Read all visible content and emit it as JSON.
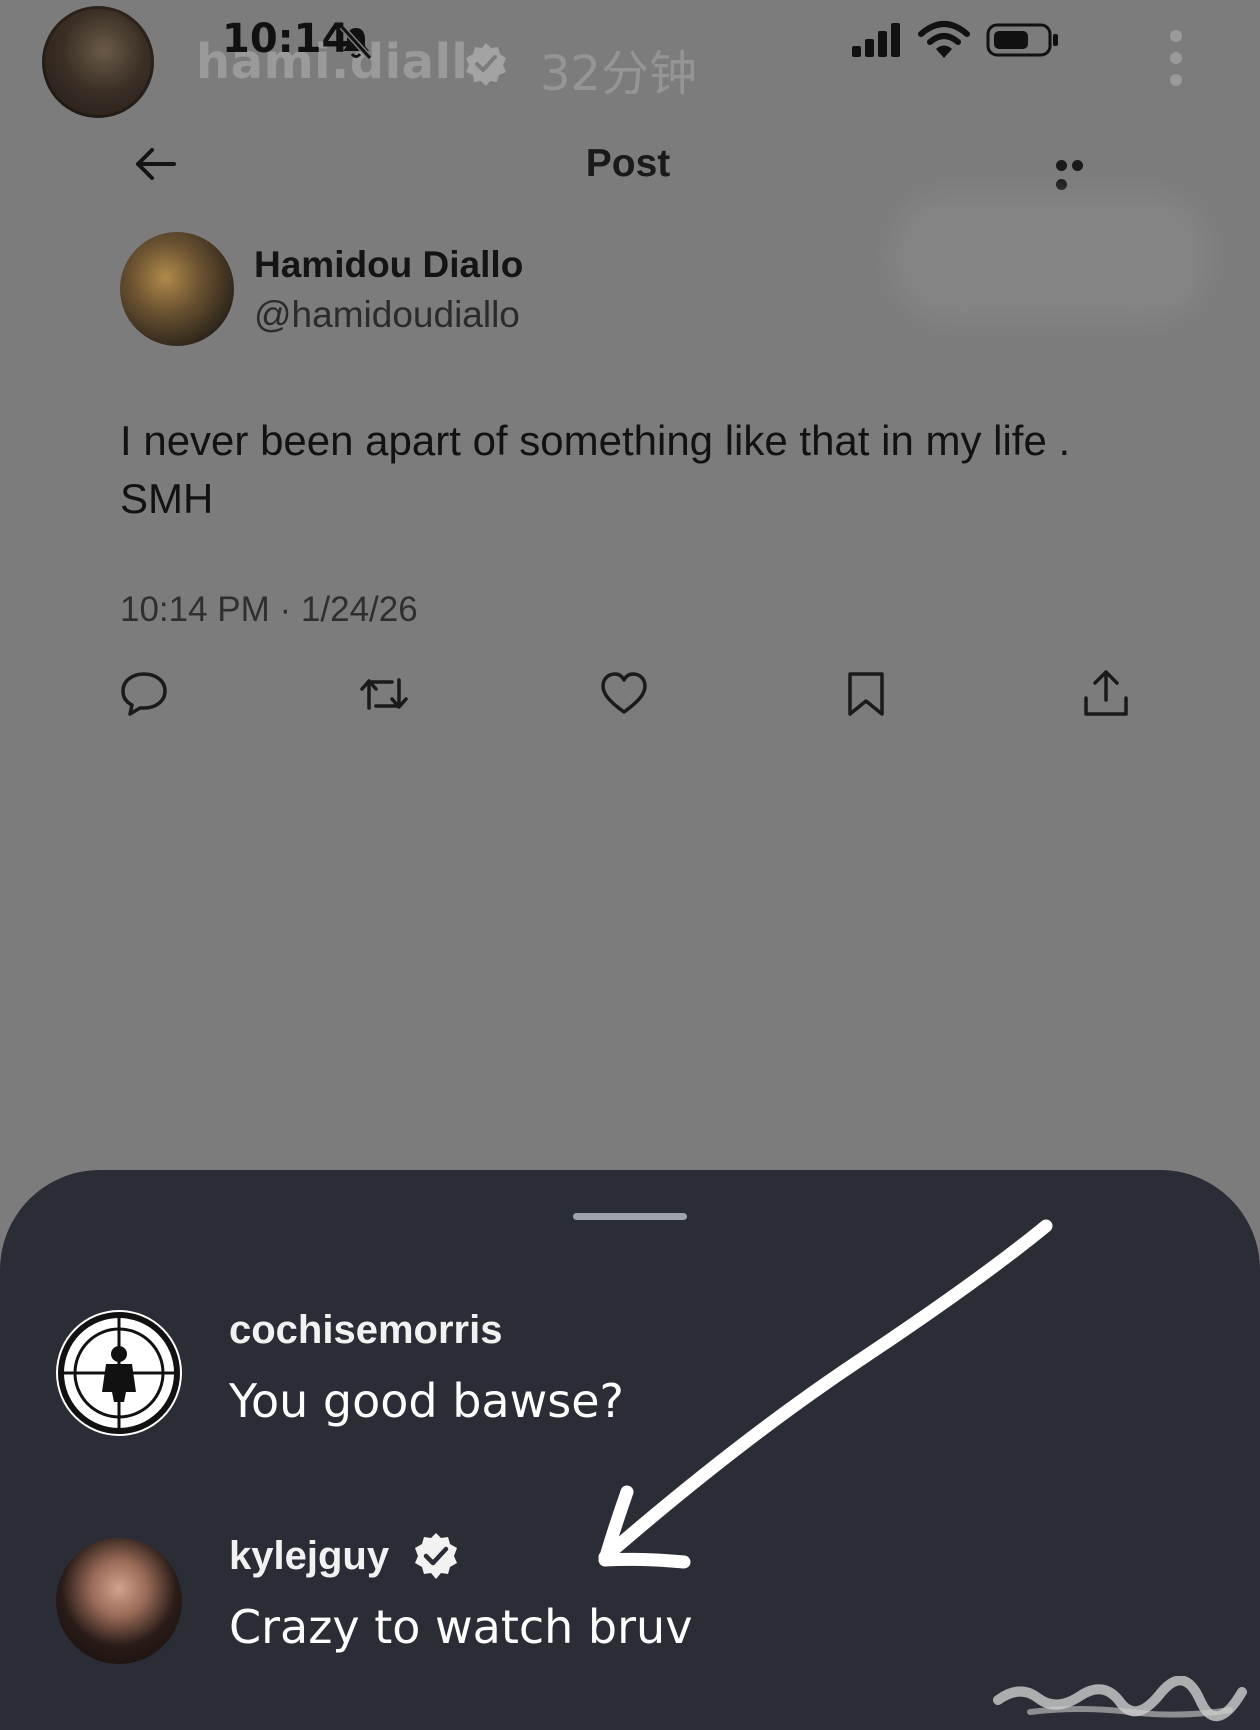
{
  "story_overlay": {
    "username": "hami.diallo",
    "time_ago": "32分钟"
  },
  "status_bar": {
    "time": "10:14"
  },
  "header": {
    "title": "Post"
  },
  "post": {
    "author_name": "Hamidou Diallo",
    "author_handle": "@hamidoudiallo",
    "text": "I never been apart of something like that in my life . SMH",
    "timestamp": "10:14 PM · 1/24/26"
  },
  "actions": [
    "reply-icon",
    "repost-icon",
    "like-icon",
    "bookmark-icon",
    "share-icon"
  ],
  "comments": [
    {
      "username": "cochisemorris",
      "text": "You good bawse?",
      "verified": false
    },
    {
      "username": "kylejguy",
      "text": "Crazy to watch bruv",
      "verified": true
    }
  ],
  "colors": {
    "dimmed_background": "#7c7c7c",
    "sheet": "#2a2d35",
    "annotation_arrow": "#ffffff"
  }
}
